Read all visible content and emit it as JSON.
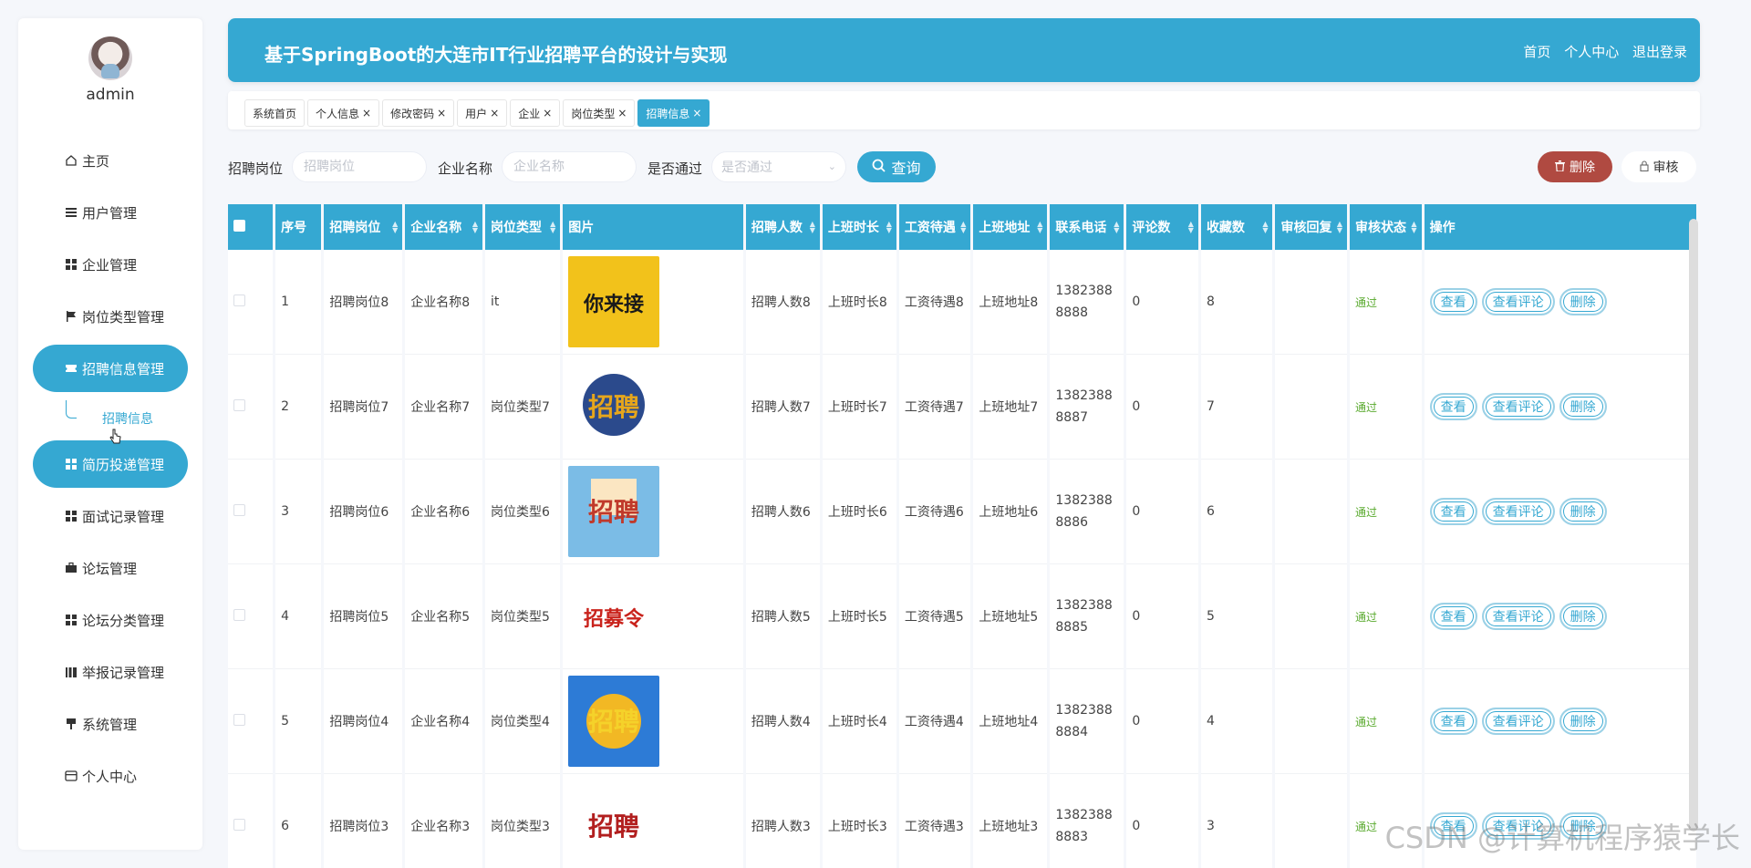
{
  "user": {
    "name": "admin"
  },
  "menu": {
    "items": [
      {
        "label": "主页",
        "icon": "home-icon"
      },
      {
        "label": "用户管理",
        "icon": "list-icon"
      },
      {
        "label": "企业管理",
        "icon": "grid-icon"
      },
      {
        "label": "岗位类型管理",
        "icon": "flag-icon"
      },
      {
        "label": "招聘信息管理",
        "icon": "ticket-icon"
      },
      {
        "label": "简历投递管理",
        "icon": "grid-icon"
      },
      {
        "label": "面试记录管理",
        "icon": "grid-icon"
      },
      {
        "label": "论坛管理",
        "icon": "briefcase-icon"
      },
      {
        "label": "论坛分类管理",
        "icon": "grid-icon"
      },
      {
        "label": "举报记录管理",
        "icon": "chart-icon"
      },
      {
        "label": "系统管理",
        "icon": "pin-icon"
      },
      {
        "label": "个人中心",
        "icon": "card-icon"
      }
    ],
    "sub_item": "招聘信息"
  },
  "header": {
    "title": "基于SpringBoot的大连市IT行业招聘平台的设计与实现",
    "links": {
      "home": "首页",
      "profile": "个人中心",
      "logout": "退出登录"
    }
  },
  "tabs": [
    {
      "label": "系统首页",
      "closable": false
    },
    {
      "label": "个人信息",
      "closable": true
    },
    {
      "label": "修改密码",
      "closable": true
    },
    {
      "label": "用户",
      "closable": true
    },
    {
      "label": "企业",
      "closable": true
    },
    {
      "label": "岗位类型",
      "closable": true
    },
    {
      "label": "招聘信息",
      "closable": true,
      "active": true
    }
  ],
  "tab_close": "×",
  "search": {
    "job_label": "招聘岗位",
    "job_placeholder": "招聘岗位",
    "company_label": "企业名称",
    "company_placeholder": "企业名称",
    "pass_label": "是否通过",
    "pass_placeholder": "是否通过",
    "query_label": "查询",
    "delete_label": "删除",
    "audit_label": "审核"
  },
  "table": {
    "headers": [
      "序号",
      "招聘岗位",
      "企业名称",
      "岗位类型",
      "图片",
      "招聘人数",
      "上班时长",
      "工资待遇",
      "上班地址",
      "联系电话",
      "评论数",
      "收藏数",
      "审核回复",
      "审核状态",
      "操作"
    ],
    "actions": {
      "view": "查看",
      "comments": "查看评论",
      "delete": "删除"
    },
    "rows": [
      {
        "no": "1",
        "job": "招聘岗位8",
        "company": "企业名称8",
        "type": "it",
        "count": "招聘人数8",
        "hours": "上班时长8",
        "salary": "工资待遇8",
        "address": "上班地址8",
        "phone": "13823888888",
        "comments": "0",
        "favorites": "8",
        "reply": "",
        "status": "通过"
      },
      {
        "no": "2",
        "job": "招聘岗位7",
        "company": "企业名称7",
        "type": "岗位类型7",
        "count": "招聘人数7",
        "hours": "上班时长7",
        "salary": "工资待遇7",
        "address": "上班地址7",
        "phone": "13823888887",
        "comments": "0",
        "favorites": "7",
        "reply": "",
        "status": "通过"
      },
      {
        "no": "3",
        "job": "招聘岗位6",
        "company": "企业名称6",
        "type": "岗位类型6",
        "count": "招聘人数6",
        "hours": "上班时长6",
        "salary": "工资待遇6",
        "address": "上班地址6",
        "phone": "13823888886",
        "comments": "0",
        "favorites": "6",
        "reply": "",
        "status": "通过"
      },
      {
        "no": "4",
        "job": "招聘岗位5",
        "company": "企业名称5",
        "type": "岗位类型5",
        "count": "招聘人数5",
        "hours": "上班时长5",
        "salary": "工资待遇5",
        "address": "上班地址5",
        "phone": "13823888885",
        "comments": "0",
        "favorites": "5",
        "reply": "",
        "status": "通过"
      },
      {
        "no": "5",
        "job": "招聘岗位4",
        "company": "企业名称4",
        "type": "岗位类型4",
        "count": "招聘人数4",
        "hours": "上班时长4",
        "salary": "工资待遇4",
        "address": "上班地址4",
        "phone": "13823888884",
        "comments": "0",
        "favorites": "4",
        "reply": "",
        "status": "通过"
      },
      {
        "no": "6",
        "job": "招聘岗位3",
        "company": "企业名称3",
        "type": "岗位类型3",
        "count": "招聘人数3",
        "hours": "上班时长3",
        "salary": "工资待遇3",
        "address": "上班地址3",
        "phone": "13823888883",
        "comments": "0",
        "favorites": "3",
        "reply": "",
        "status": "通过"
      }
    ],
    "images": [
      {
        "text": "你来接",
        "bg": "#f2c21b",
        "fg": "#1a1a1a"
      },
      {
        "text": "招聘",
        "bg": "#ffffff",
        "fg": "#e6a61c"
      },
      {
        "text": "招聘",
        "bg": "#7bbce6",
        "fg": "#c0392b"
      },
      {
        "text": "招募令",
        "bg": "#ffffff",
        "fg": "#c9231c"
      },
      {
        "text": "招聘",
        "bg": "#2d7bd6",
        "fg": "#f5d22a"
      },
      {
        "text": "招聘",
        "bg": "#ffffff",
        "fg": "#b21f1f"
      }
    ]
  },
  "watermark": "CSDN @计算机程序猿学长",
  "colors": {
    "primary": "#35a8d2",
    "danger": "#b04a41",
    "pass": "#5aaa2e"
  }
}
